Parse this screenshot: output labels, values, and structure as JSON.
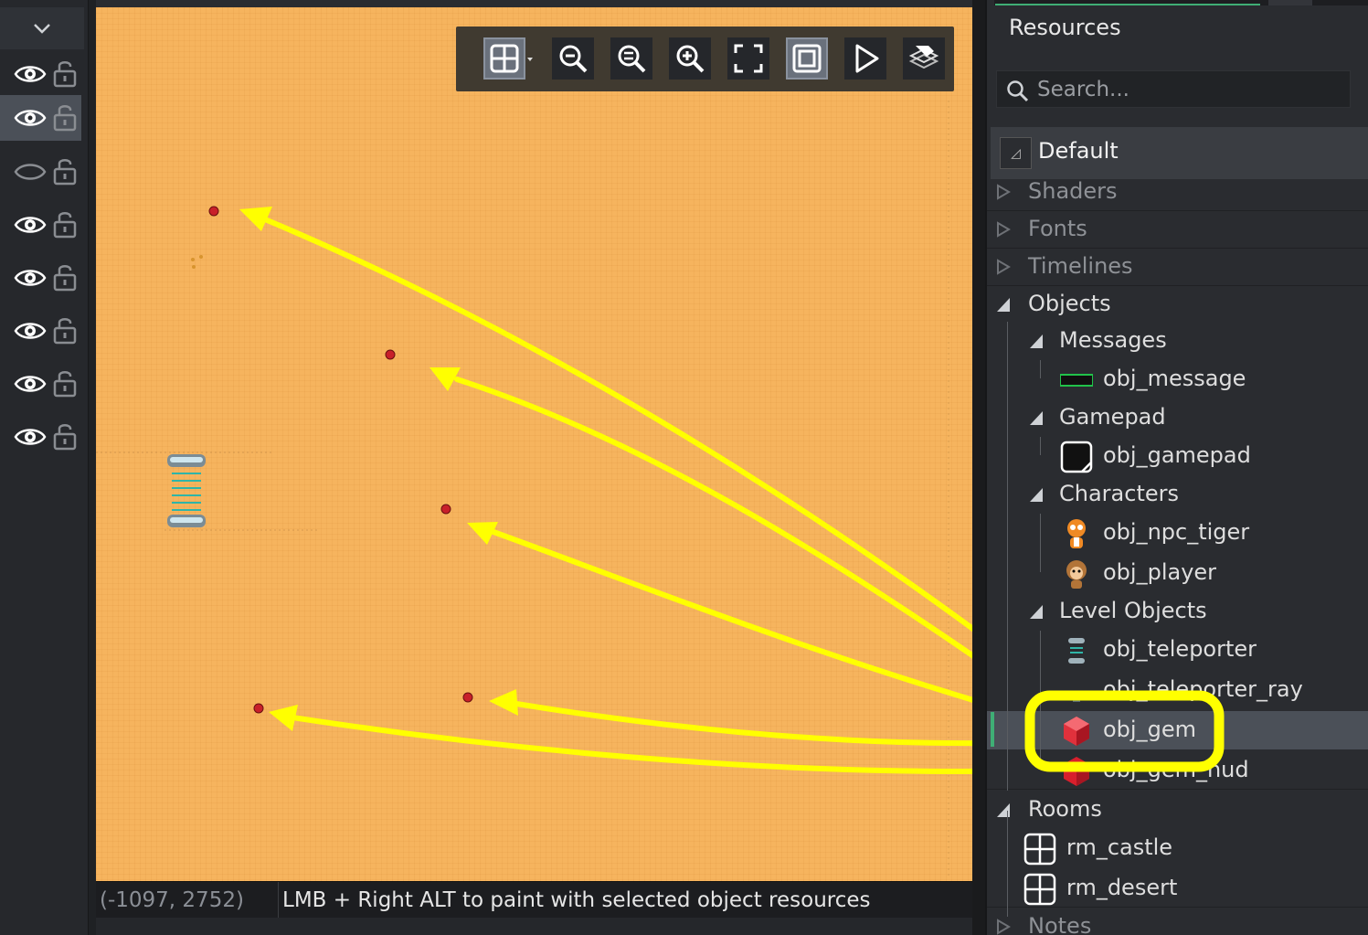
{
  "layers_panel": {
    "collapse_icon": "chevron-down-icon",
    "rows": [
      {
        "visible": true,
        "locked": false,
        "selected": false
      },
      {
        "visible": true,
        "locked": false,
        "selected": true
      },
      {
        "visible": false,
        "locked": false,
        "selected": false
      },
      {
        "visible": true,
        "locked": false,
        "selected": false
      },
      {
        "visible": true,
        "locked": false,
        "selected": false
      },
      {
        "visible": true,
        "locked": false,
        "selected": false
      },
      {
        "visible": true,
        "locked": false,
        "selected": false
      },
      {
        "visible": true,
        "locked": false,
        "selected": false
      }
    ]
  },
  "room_toolbar": {
    "buttons": [
      "grid-icon",
      "zoom-out-icon",
      "zoom-reset-icon",
      "zoom-in-icon",
      "fit-view-icon",
      "frame-icon",
      "play-icon",
      "layer-tool-icon"
    ]
  },
  "room": {
    "background_color": "#f6b45e",
    "instances": [
      "obj_gem",
      "obj_gem",
      "obj_gem",
      "obj_gem",
      "obj_gem",
      "obj_teleporter"
    ]
  },
  "annotation": {
    "arrow_color": "#ffff00",
    "highlight_target": "obj_gem"
  },
  "status_bar": {
    "coords": "(-1097, 2752)",
    "hint": "LMB + Right ALT to paint with selected object resources"
  },
  "resources": {
    "title": "Resources",
    "search_placeholder": "Search...",
    "default_group": "Default",
    "tree": {
      "shaders": "Shaders",
      "fonts": "Fonts",
      "timelines": "Timelines",
      "objects": "Objects",
      "messages": "Messages",
      "obj_message": "obj_message",
      "gamepad": "Gamepad",
      "obj_gamepad": "obj_gamepad",
      "characters": "Characters",
      "obj_npc_tiger": "obj_npc_tiger",
      "obj_player": "obj_player",
      "level_objects": "Level Objects",
      "obj_teleporter": "obj_teleporter",
      "obj_teleporter_ray": "obj_teleporter_ray",
      "obj_gem": "obj_gem",
      "obj_gem_hud": "obj_gem_hud",
      "rooms": "Rooms",
      "rm_castle": "rm_castle",
      "rm_desert": "rm_desert",
      "notes": "Notes"
    }
  }
}
